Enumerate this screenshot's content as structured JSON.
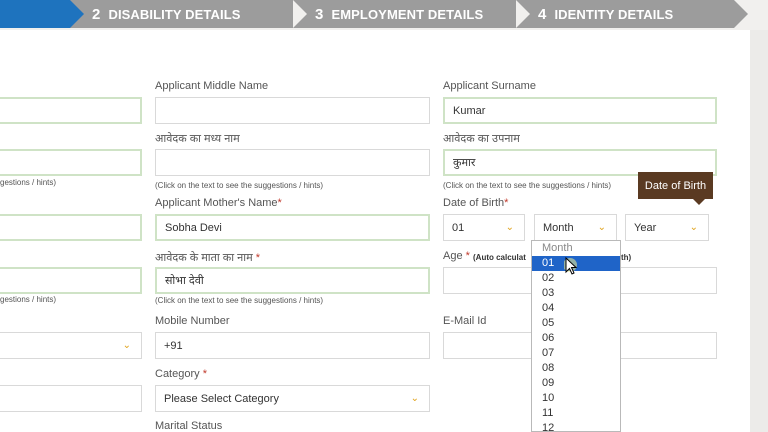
{
  "steps": [
    {
      "num": "2",
      "label": "DISABILITY DETAILS"
    },
    {
      "num": "3",
      "label": "EMPLOYMENT DETAILS"
    },
    {
      "num": "4",
      "label": "IDENTITY DETAILS"
    }
  ],
  "form": {
    "middle_name_label": "Applicant Middle Name",
    "surname_label": "Applicant Surname",
    "surname_value": "Kumar",
    "middle_name_hi_label": "आवेदक का मध्य नाम",
    "surname_hi_label": "आवेदक का उपनाम",
    "surname_hi_value": "कुमार",
    "hint_left_cut": "gestions / hints)",
    "hint": "(Click on the text to see the suggestions / hints)",
    "mother_label": "Applicant Mother's Name",
    "mother_value": "Sobha Devi",
    "dob_label": "Date of Birth",
    "dob_day": "01",
    "dob_month": "Month",
    "dob_year": "Year",
    "mother_hi_label": "आवेदक के माता का नाम",
    "mother_hi_value": "सोभा देवी",
    "age_label": "Age",
    "age_note": "(Auto calculat",
    "age_note_tail": "th)",
    "mobile_label": "Mobile Number",
    "mobile_value": "+91",
    "email_label": "E-Mail Id",
    "category_label": "Category",
    "category_value": "Please Select Category",
    "marital_label": "Marital Status",
    "required_mark": "*"
  },
  "tooltip": "Date of Birth",
  "month_dropdown": {
    "header": "Month",
    "selected": "01",
    "options": [
      "01",
      "02",
      "03",
      "04",
      "05",
      "06",
      "07",
      "08",
      "09",
      "10",
      "11",
      "12"
    ]
  },
  "colors": {
    "step_bg": "#9c9c9c",
    "selected": "#1f64c8",
    "tooltip_bg": "#5a3a22",
    "arrow": "#e0a31c"
  }
}
